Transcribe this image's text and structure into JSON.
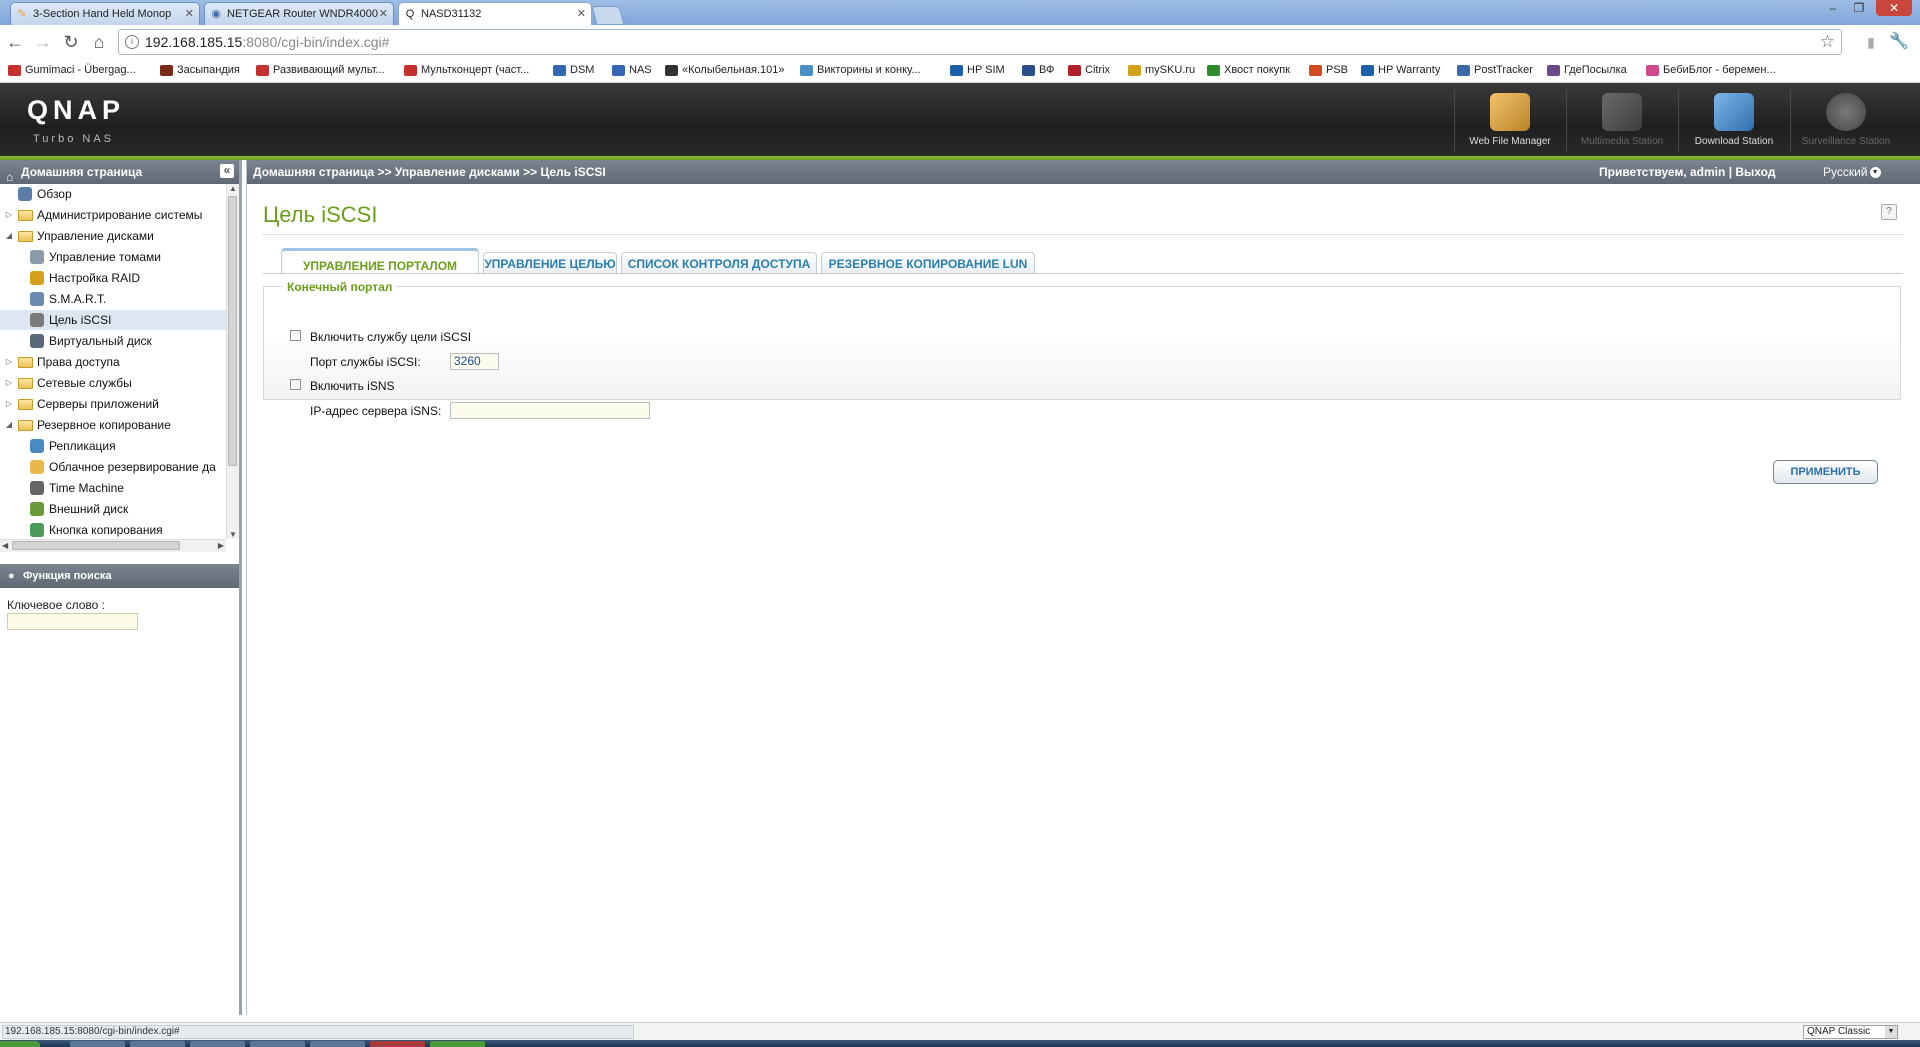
{
  "browser": {
    "tabs": [
      {
        "title": "3-Section Hand Held Monop",
        "icon": "pencil-icon",
        "color": "#e8a23a"
      },
      {
        "title": "NETGEAR Router WNDR4000",
        "icon": "globe-icon",
        "color": "#3d6db0"
      },
      {
        "title": "NASD31132",
        "icon": "qnap-icon",
        "color": "#222222"
      }
    ],
    "url_host": "192.168.185.15",
    "url_path": ":8080/cgi-bin/index.cgi#",
    "bookmarks": [
      {
        "label": "Gumimaci - Übergag...",
        "color": "#c4302b"
      },
      {
        "label": "Засыпандия",
        "color": "#7a2b1a"
      },
      {
        "label": "Развивающий мульт...",
        "color": "#c4302b"
      },
      {
        "label": "Мультконцерт (част...",
        "color": "#c4302b"
      },
      {
        "label": "DSM",
        "color": "#3466b4"
      },
      {
        "label": "NAS",
        "color": "#3466b4"
      },
      {
        "label": "«Колыбельная.101»",
        "color": "#333333"
      },
      {
        "label": "Викторины и конку...",
        "color": "#4a90c4"
      },
      {
        "label": "HP SIM",
        "color": "#1d5fa8"
      },
      {
        "label": "ВФ",
        "color": "#2b4d8a"
      },
      {
        "label": "Citrix",
        "color": "#b01f2a"
      },
      {
        "label": "mySKU.ru",
        "color": "#d4a21a"
      },
      {
        "label": "Хвост покупк",
        "color": "#2e8b2e"
      },
      {
        "label": "PSB",
        "color": "#d24a1d"
      },
      {
        "label": "HP Warranty",
        "color": "#1d5fa8"
      },
      {
        "label": "PostTracker",
        "color": "#3a6aa8"
      },
      {
        "label": "ГдеПосылка",
        "color": "#6a4a8a"
      },
      {
        "label": "БебиБлог - беремен...",
        "color": "#d04a8a"
      }
    ]
  },
  "header": {
    "logo": "QNAP",
    "subtitle": "Turbo NAS",
    "apps": [
      {
        "label": "Web File Manager",
        "enabled": true
      },
      {
        "label": "Multimedia Station",
        "enabled": false
      },
      {
        "label": "Download Station",
        "enabled": true
      },
      {
        "label": "Surveillance Station",
        "enabled": false
      }
    ]
  },
  "sidebar": {
    "title": "Домашняя страница",
    "items": [
      {
        "label": "Обзор",
        "level": 0,
        "type": "leaf"
      },
      {
        "label": "Администрирование системы",
        "level": 0,
        "type": "folder",
        "expanded": false
      },
      {
        "label": "Управление дисками",
        "level": 0,
        "type": "folder",
        "expanded": true
      },
      {
        "label": "Управление томами",
        "level": 1,
        "type": "leaf"
      },
      {
        "label": "Настройка RAID",
        "level": 1,
        "type": "leaf"
      },
      {
        "label": "S.M.A.R.T.",
        "level": 1,
        "type": "leaf"
      },
      {
        "label": "Цель iSCSI",
        "level": 1,
        "type": "leaf",
        "selected": true
      },
      {
        "label": "Виртуальный диск",
        "level": 1,
        "type": "leaf"
      },
      {
        "label": "Права доступа",
        "level": 0,
        "type": "folder",
        "expanded": false
      },
      {
        "label": "Сетевые службы",
        "level": 0,
        "type": "folder",
        "expanded": false
      },
      {
        "label": "Серверы приложений",
        "level": 0,
        "type": "folder",
        "expanded": false
      },
      {
        "label": "Резервное копирование",
        "level": 0,
        "type": "folder",
        "expanded": true
      },
      {
        "label": "Репликация",
        "level": 1,
        "type": "leaf"
      },
      {
        "label": "Облачное резервирование да",
        "level": 1,
        "type": "leaf"
      },
      {
        "label": "Time Machine",
        "level": 1,
        "type": "leaf"
      },
      {
        "label": "Внешний диск",
        "level": 1,
        "type": "leaf"
      },
      {
        "label": "Кнопка копирования",
        "level": 1,
        "type": "leaf"
      }
    ],
    "search_title": "Функция поиска",
    "keyword_label": "Ключевое слово :",
    "keyword_value": ""
  },
  "topbar": {
    "breadcrumb": "Домашняя страница >> Управление дисками >> Цель iSCSI",
    "greeting": "Приветствуем,",
    "user": "admin",
    "separator": "|",
    "logout": "Выход",
    "language": "Русский"
  },
  "page": {
    "title": "Цель iSCSI",
    "tabs": [
      {
        "label": "УПРАВЛЕНИЕ ПОРТАЛОМ",
        "active": true
      },
      {
        "label": "УПРАВЛЕНИЕ ЦЕЛЬЮ",
        "active": false
      },
      {
        "label": "СПИСОК КОНТРОЛЯ ДОСТУПА",
        "active": false
      },
      {
        "label": "РЕЗЕРВНОЕ КОПИРОВАНИЕ LUN",
        "active": false
      }
    ],
    "portal": {
      "legend": "Конечный портал",
      "enable_iscsi_label": "Включить службу цели iSCSI",
      "enable_iscsi_checked": false,
      "port_label": "Порт службы iSCSI:",
      "port_value": "3260",
      "enable_isns_label": "Включить iSNS",
      "enable_isns_checked": false,
      "isns_ip_label": "IP-адрес сервера iSNS:",
      "isns_ip_value": ""
    },
    "apply_label": "ПРИМЕНИТЬ"
  },
  "status": {
    "url": "192.168.185.15:8080/cgi-bin/index.cgi#",
    "theme": "QNAP Classic"
  }
}
